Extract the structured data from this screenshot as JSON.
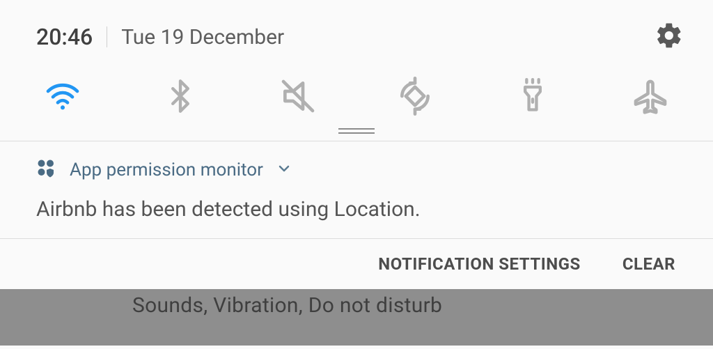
{
  "status": {
    "time": "20:46",
    "date": "Tue 19 December"
  },
  "quick_settings": {
    "wifi_active": true,
    "items": [
      "wifi",
      "bluetooth",
      "mute",
      "auto-rotate",
      "flashlight",
      "airplane"
    ]
  },
  "notification": {
    "app_name": "App permission monitor",
    "body": "Airbnb has been detected using Location."
  },
  "actions": {
    "settings_label": "NOTIFICATION SETTINGS",
    "clear_label": "CLEAR"
  },
  "background": {
    "partial_text": "Sounds, Vibration, Do not disturb"
  },
  "colors": {
    "accent": "#2196f3",
    "icon_inactive": "#b0b0b0",
    "text_primary": "#4d4d4d",
    "notif_app": "#4a6b84"
  }
}
